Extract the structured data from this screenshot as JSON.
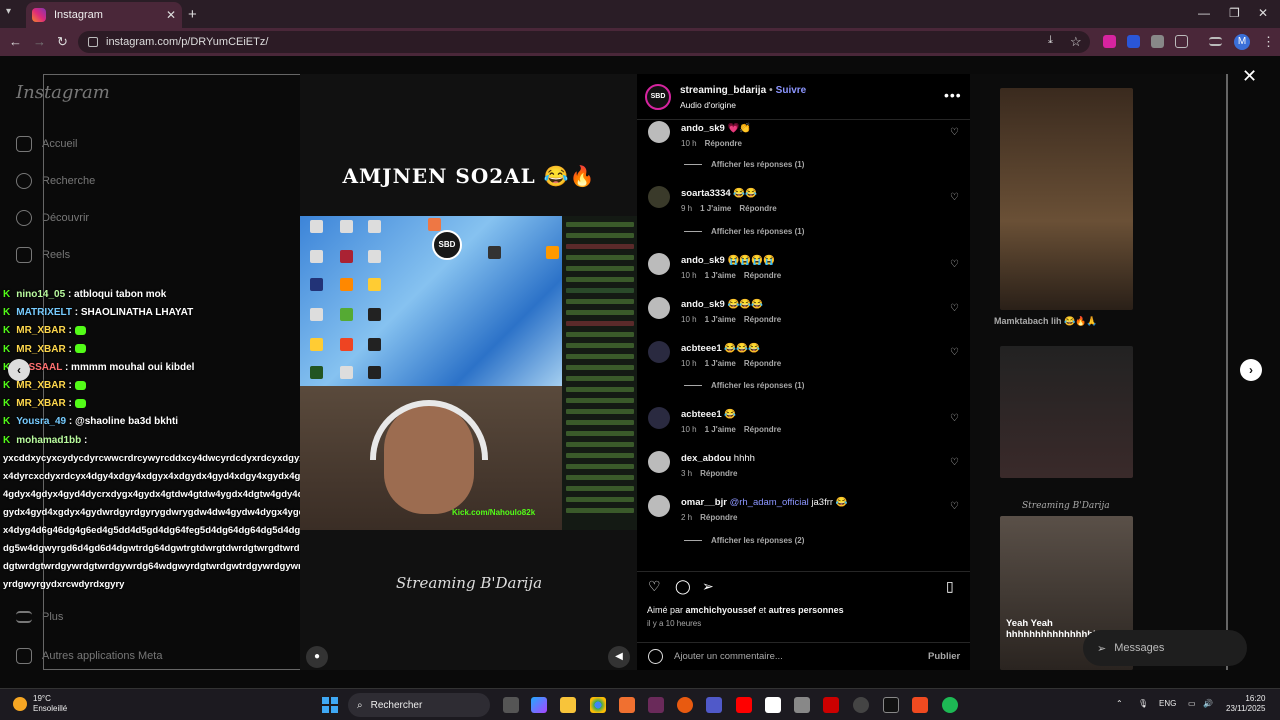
{
  "browser": {
    "tab_title": "Instagram",
    "url": "instagram.com/p/DRYumCEiETz/",
    "profile_initial": "M"
  },
  "sidebar": {
    "logo": "Instagram",
    "items": [
      {
        "label": "Accueil",
        "icon": "home-icon"
      },
      {
        "label": "Recherche",
        "icon": "search-icon"
      },
      {
        "label": "Découvrir",
        "icon": "compass-icon"
      },
      {
        "label": "Reels",
        "icon": "reels-icon"
      },
      {
        "label": "Plus",
        "icon": "menu-icon"
      },
      {
        "label": "Autres applications Meta",
        "icon": "apps-icon"
      }
    ]
  },
  "chat": [
    {
      "user": "nino14_05",
      "text": ": atbloqui tabon mok"
    },
    {
      "user": "MATRIXELT",
      "text": ": SHAOLINATHA LHAYAT"
    },
    {
      "user": "MR_XBAR",
      "text": ":"
    },
    {
      "user": "MR_XBAR",
      "text": ":"
    },
    {
      "user": "WISSAAL",
      "text": ": mmmm mouhal oui kibdel"
    },
    {
      "user": "MR_XBAR",
      "text": ":"
    },
    {
      "user": "MR_XBAR",
      "text": ":"
    },
    {
      "user": "Yousra_49",
      "text": ": @shaoline ba3d bkhti"
    },
    {
      "user": "mohamad1bb",
      "text": ":"
    },
    {
      "user": "",
      "text": "yxcddxycyxcydycdyrcwwcrdrcywyrcddxcy4dwcyrdcdyxrdcyxdgyxcyx46d6dcxydcx4dyrcxcdyxrdcyx4dgy4xdgy4xdgyx4xdgydx4gyd4xdgy4xgydx4gydx4dcy4xdgyx4gdyx4gdyx4gyd4dycrxdygx4gydx4gtdw4gtdw4ygdx4dgtw4gdy4dgy4dgy4gdyx4gydx4gyd4xgdyx4gydwrdgyrdgyrygdwrygdw4dw4gydw4dygx4ygdddyg4dyg4dgyx4dyg4d6g46dg4g6ed4g5dd4d5gd4dg64feg5d4dg64dg64dg5d4dgwtrdg5d4d5gd4dg5w4dgwyrgd6d4gd6d4dgwtrdg64dgwtrgtdwrgtdwrdgtwrgdtwrdgtrwdgwtrdgtwrdgtwrdgtwrdgywrdgtwrdgywrdg64wdgwyrdgtwrdgwtrdgywrdgywrgdtwrdgtwrdgwyrdgwyrgydxrcwdyrdxgyry"
    }
  ],
  "video": {
    "title": "AMJNEN SO2AL 😂🔥",
    "channel_badge": "SBD",
    "kick_url": "Kick.com/Nahoulo82k",
    "footer": "Streaming B'Darija"
  },
  "post": {
    "username": "streaming_bdarija",
    "follow": "Suivre",
    "audio": "Audio d'origine",
    "avatar_text": "SBD",
    "comments": [
      {
        "user": "ando_sk9",
        "text": "💗👏",
        "time": "10 h",
        "likes": "",
        "reply": "Répondre",
        "avatar": "grey"
      },
      {
        "user": "soarta3334",
        "text": "😂😂",
        "time": "9 h",
        "likes": "1 J'aime",
        "reply": "Répondre",
        "avatar": "dark"
      },
      {
        "user": "ando_sk9",
        "text": "😭😭😭😭",
        "time": "10 h",
        "likes": "1 J'aime",
        "reply": "Répondre",
        "avatar": "grey"
      },
      {
        "user": "ando_sk9",
        "text": "😂😂😂",
        "time": "10 h",
        "likes": "1 J'aime",
        "reply": "Répondre",
        "avatar": "grey"
      },
      {
        "user": "acbteee1",
        "text": "😂😂😂",
        "time": "10 h",
        "likes": "1 J'aime",
        "reply": "Répondre",
        "avatar": "blue"
      },
      {
        "user": "acbteee1",
        "text": "😂",
        "time": "10 h",
        "likes": "1 J'aime",
        "reply": "Répondre",
        "avatar": "blue"
      },
      {
        "user": "dex_abdou",
        "text": "hhhh",
        "time": "3 h",
        "likes": "",
        "reply": "Répondre",
        "avatar": "grey"
      },
      {
        "user": "omar__bjr",
        "mention": "@rh_adam_official",
        "text": "ja3frr 😂",
        "time": "2 h",
        "likes": "",
        "reply": "Répondre",
        "avatar": "grey"
      }
    ],
    "replies": [
      {
        "label": "Afficher les réponses (1)"
      },
      {
        "label": "Afficher les réponses (1)"
      },
      {
        "label": "Afficher les réponses (1)"
      },
      {
        "label": "Afficher les réponses (2)"
      }
    ],
    "liked_prefix": "Aimé par",
    "liked_user": "amchichyoussef",
    "liked_mid": "et",
    "liked_others": "autres personnes",
    "ago": "il y a 10 heures",
    "add_comment": "Ajouter un commentaire...",
    "publish": "Publier"
  },
  "right_previews": {
    "label1": "Mamktabach lih 😂🔥🙏",
    "label2": "Streaming B'Darija",
    "overlay": "Yeah Yeah hhhhhhhhhhhhhhhh",
    "messages": "Messages"
  },
  "taskbar": {
    "temp": "19°C",
    "weather": "Ensoleillé",
    "search": "Rechercher",
    "lang": "ENG",
    "time": "16:20",
    "date": "23/11/2025"
  },
  "colors": {
    "accent_link": "#8c96ff",
    "kick_green": "#53fc18",
    "tab_bg": "#4a2739"
  }
}
